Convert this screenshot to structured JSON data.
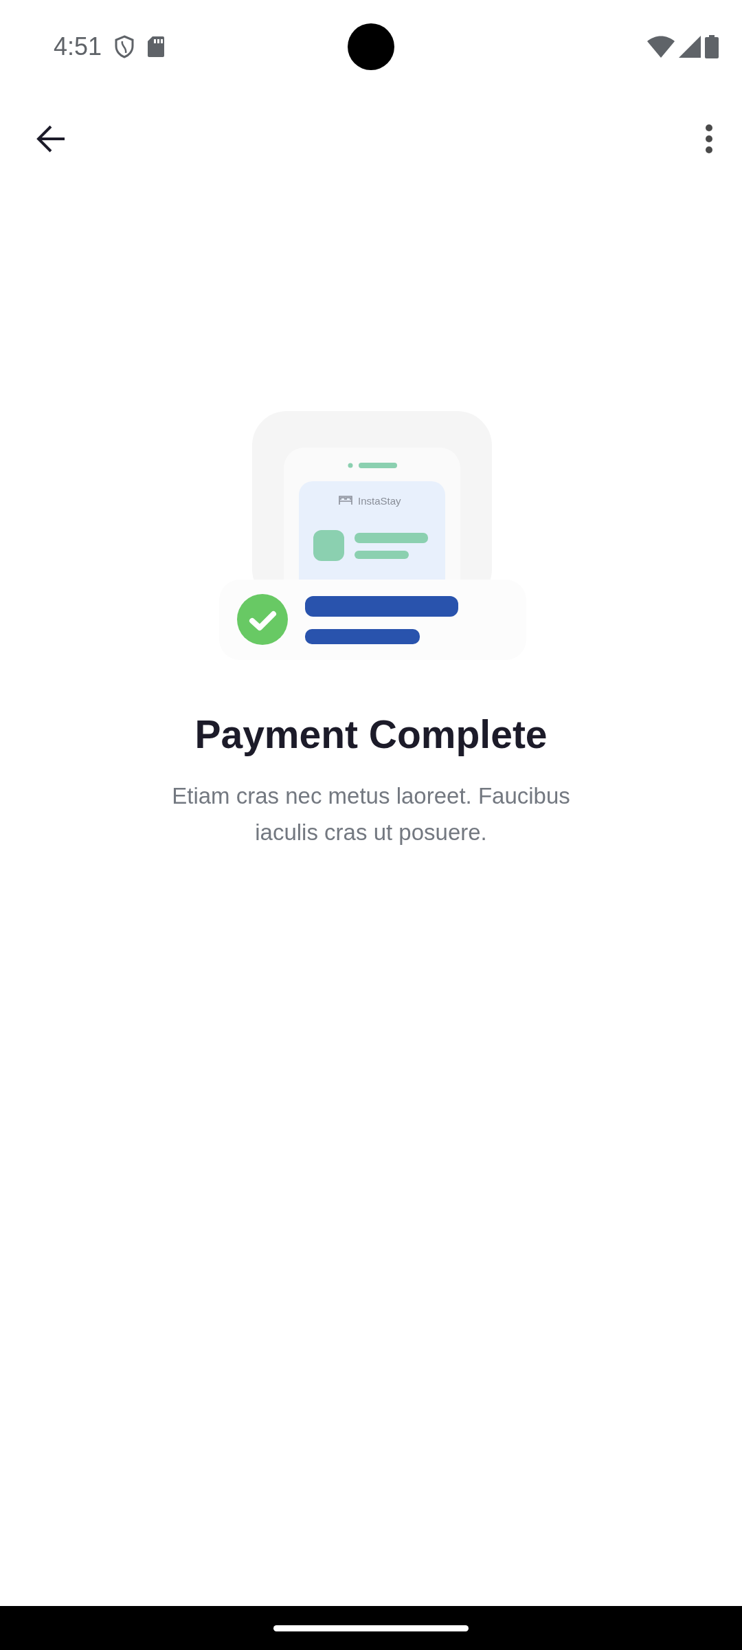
{
  "status_bar": {
    "time": "4:51"
  },
  "illustration": {
    "brand": "InstaStay"
  },
  "title": "Payment Complete",
  "message": "Etiam cras nec metus laoreet. Faucibus iaculis cras ut posuere."
}
